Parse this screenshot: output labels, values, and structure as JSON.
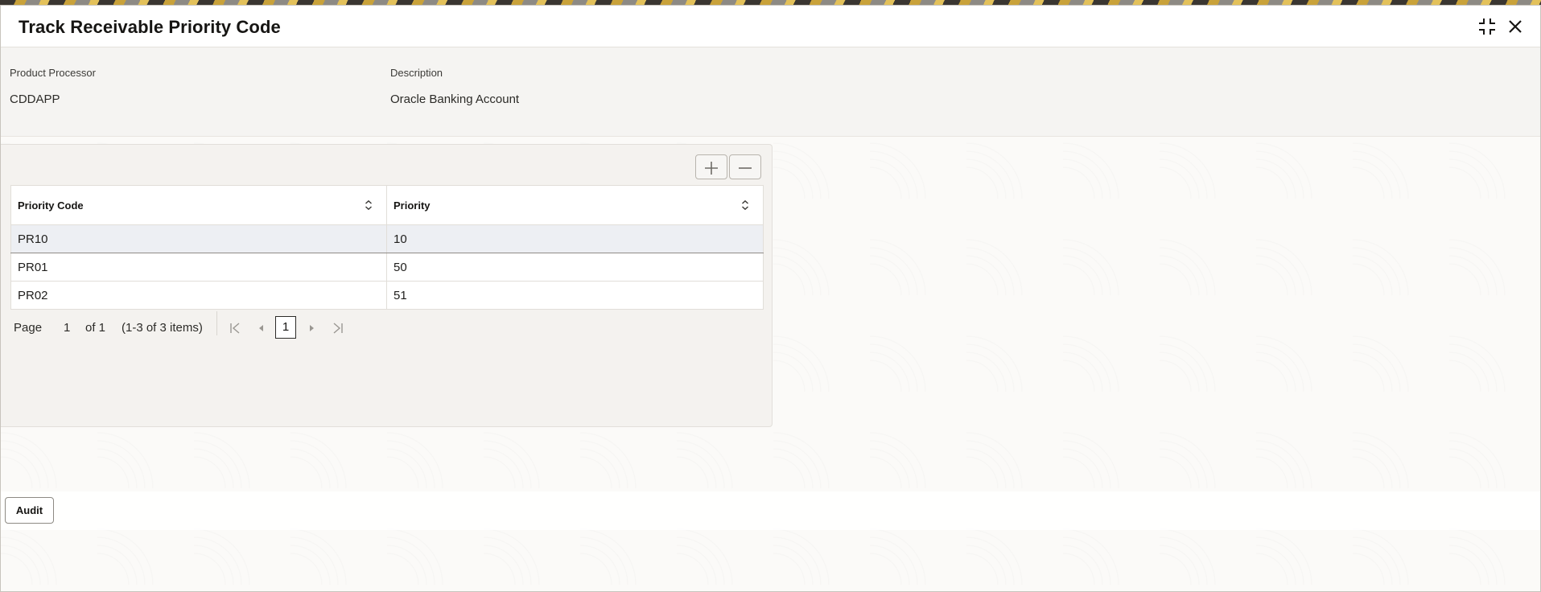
{
  "dialog": {
    "title": "Track Receivable Priority Code"
  },
  "info": {
    "product_processor_label": "Product Processor",
    "product_processor_value": "CDDAPP",
    "description_label": "Description",
    "description_value": "Oracle Banking Account"
  },
  "grid": {
    "columns": [
      "Priority Code",
      "Priority"
    ],
    "rows": [
      {
        "priority_code": "PR10",
        "priority": "10",
        "selected": true
      },
      {
        "priority_code": "PR01",
        "priority": "50",
        "selected": false
      },
      {
        "priority_code": "PR02",
        "priority": "51",
        "selected": false
      }
    ]
  },
  "pager": {
    "page_label": "Page",
    "page_value": "1",
    "of_label": "of 1",
    "items_label": "(1-3 of 3 items)",
    "current_page": "1"
  },
  "footer": {
    "audit_label": "Audit"
  },
  "icons": {
    "restore": "compress-icon",
    "close": "close-icon",
    "add": "plus-icon",
    "remove": "minus-icon",
    "sort": "sort-icon",
    "first": "first-page-icon",
    "prev": "prev-page-icon",
    "next": "next-page-icon",
    "last": "last-page-icon"
  }
}
